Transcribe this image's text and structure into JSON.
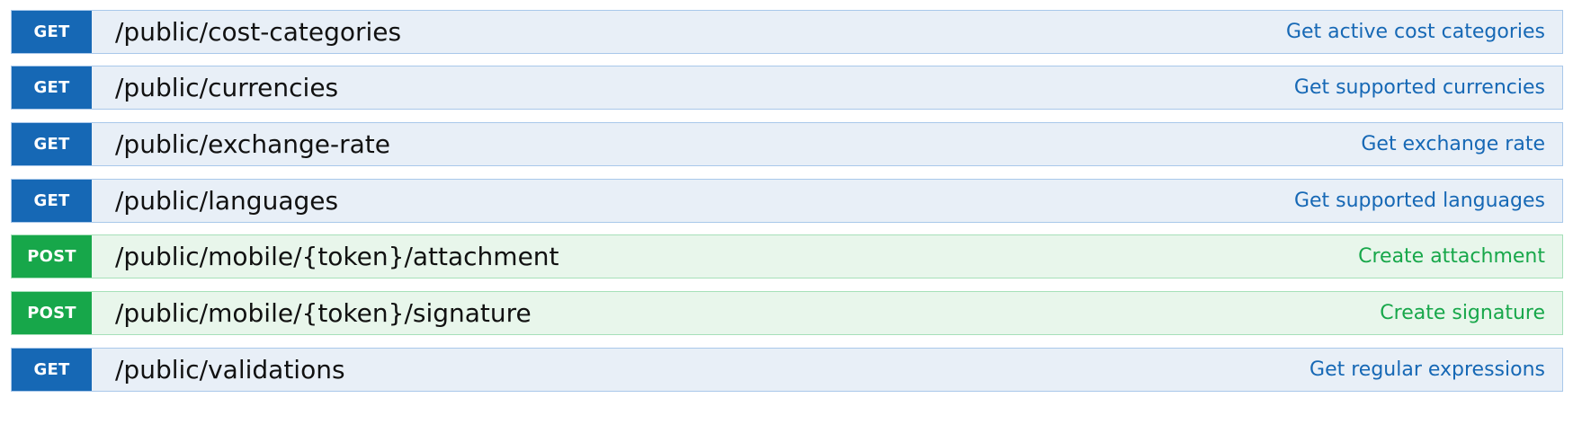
{
  "colors": {
    "get_accent": "#1668b5",
    "get_background": "#e8eff7",
    "get_border": "#a9c8ea",
    "post_accent": "#17a74a",
    "post_background": "#e8f6eb",
    "post_border": "#a6e0b9"
  },
  "operations": [
    {
      "method": "GET",
      "path": "/public/cost-categories",
      "summary": "Get active cost categories"
    },
    {
      "method": "GET",
      "path": "/public/currencies",
      "summary": "Get supported currencies"
    },
    {
      "method": "GET",
      "path": "/public/exchange-rate",
      "summary": "Get exchange rate"
    },
    {
      "method": "GET",
      "path": "/public/languages",
      "summary": "Get supported languages"
    },
    {
      "method": "POST",
      "path": "/public/mobile/{token}/attachment",
      "summary": "Create attachment"
    },
    {
      "method": "POST",
      "path": "/public/mobile/{token}/signature",
      "summary": "Create signature"
    },
    {
      "method": "GET",
      "path": "/public/validations",
      "summary": "Get regular expressions"
    }
  ]
}
